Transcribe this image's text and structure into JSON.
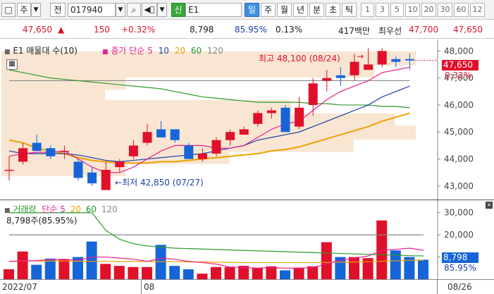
{
  "toolbar": {
    "market": "주",
    "all_label": "전",
    "code": "017940",
    "search_label": "Q",
    "signal_label": "신",
    "name": "E1",
    "period_tabs": [
      "일",
      "주",
      "월",
      "년",
      "분",
      "초",
      "틱"
    ],
    "active_period": "일",
    "interval_tabs": [
      "1",
      "3",
      "5",
      "10",
      "20",
      "30",
      "60",
      "12"
    ]
  },
  "quote": {
    "price": "47,650",
    "arrow": "▲",
    "change": "150",
    "change_pct": "+0.32%",
    "volume": "8,798",
    "vol_ratio": "85.95%",
    "turnover_pct": "0.13%",
    "amount": "417백만",
    "best_ask_label": "최우선",
    "ask": "47,700",
    "bid": "47,650"
  },
  "main_chart": {
    "legend_stock": "E1 매물대 수(10)",
    "legend_ma": "종가 단순",
    "ma_periods": [
      "5",
      "10",
      "20",
      "60",
      "120"
    ],
    "high_note": "최고 48,100 (08/24)",
    "low_note": "최저 42,850 (07/27)",
    "price_tag": "47,650",
    "pct_tag": "0.32%"
  },
  "volume_chart": {
    "legend": "거래량",
    "legend_ma": "단순",
    "ma_periods": [
      "5",
      "20",
      "60",
      "120"
    ],
    "current_note": "8,798주(85.95%)",
    "vol_tag": "8,798",
    "vol_pct_tag": "85.95%"
  },
  "x_labels": [
    "2022/07",
    "08",
    "08/26"
  ],
  "colors": {
    "up": "#e0102a",
    "down": "#1565d8",
    "ma5": "#e8208c",
    "ma10": "#1d3fa8",
    "ma20": "#f0a000",
    "ma60": "#2a9a2a",
    "ma120": "#888888",
    "profile": "#f8e6d2"
  },
  "chart_data": [
    {
      "type": "candlestick",
      "title": "E1",
      "ylim": [
        42500,
        48400
      ],
      "y_ticks": [
        43000,
        44000,
        45000,
        46000,
        47000,
        48000
      ],
      "candles": [
        {
          "o": 43600,
          "h": 44100,
          "l": 43200,
          "c": 43600
        },
        {
          "o": 43900,
          "h": 44600,
          "l": 43800,
          "c": 44400
        },
        {
          "o": 44600,
          "h": 44900,
          "l": 44300,
          "c": 44300
        },
        {
          "o": 44400,
          "h": 44500,
          "l": 44000,
          "c": 44100
        },
        {
          "o": 44300,
          "h": 44500,
          "l": 44000,
          "c": 44300
        },
        {
          "o": 43900,
          "h": 44000,
          "l": 43200,
          "c": 43300
        },
        {
          "o": 43500,
          "h": 43700,
          "l": 43000,
          "c": 43100
        },
        {
          "o": 42850,
          "h": 43900,
          "l": 42850,
          "c": 43600
        },
        {
          "o": 43700,
          "h": 44000,
          "l": 43500,
          "c": 43900
        },
        {
          "o": 44100,
          "h": 44700,
          "l": 44000,
          "c": 44500
        },
        {
          "o": 44600,
          "h": 45300,
          "l": 44500,
          "c": 45000
        },
        {
          "o": 45100,
          "h": 45400,
          "l": 44800,
          "c": 44800
        },
        {
          "o": 45100,
          "h": 45100,
          "l": 44600,
          "c": 44700
        },
        {
          "o": 44500,
          "h": 44600,
          "l": 44000,
          "c": 44000
        },
        {
          "o": 44000,
          "h": 44400,
          "l": 43900,
          "c": 44200
        },
        {
          "o": 44200,
          "h": 44800,
          "l": 44100,
          "c": 44700
        },
        {
          "o": 44700,
          "h": 45100,
          "l": 44500,
          "c": 45000
        },
        {
          "o": 44900,
          "h": 45200,
          "l": 44900,
          "c": 45100
        },
        {
          "o": 45300,
          "h": 45800,
          "l": 45200,
          "c": 45700
        },
        {
          "o": 45700,
          "h": 45900,
          "l": 45500,
          "c": 45800
        },
        {
          "o": 45900,
          "h": 46000,
          "l": 45000,
          "c": 45000
        },
        {
          "o": 45200,
          "h": 46300,
          "l": 45100,
          "c": 45900
        },
        {
          "o": 46000,
          "h": 47000,
          "l": 45600,
          "c": 46800
        },
        {
          "o": 46900,
          "h": 47300,
          "l": 46500,
          "c": 47000
        },
        {
          "o": 47100,
          "h": 47400,
          "l": 46700,
          "c": 47000
        },
        {
          "o": 47100,
          "h": 47900,
          "l": 46900,
          "c": 47600
        },
        {
          "o": 47300,
          "h": 48100,
          "l": 47300,
          "c": 47500
        },
        {
          "o": 47500,
          "h": 48100,
          "l": 47400,
          "c": 48000
        },
        {
          "o": 47700,
          "h": 47800,
          "l": 47400,
          "c": 47600
        },
        {
          "o": 47700,
          "h": 47900,
          "l": 47300,
          "c": 47650
        }
      ],
      "ma5": [
        44100,
        44200,
        44250,
        44250,
        44300,
        44000,
        43700,
        43500,
        43500,
        43700,
        44000,
        44300,
        44500,
        44500,
        44500,
        44400,
        44400,
        44500,
        44800,
        45100,
        45300,
        45400,
        45800,
        46200,
        46500,
        46700,
        46900,
        47200,
        47300,
        47400
      ],
      "ma10": [
        44300,
        44200,
        44200,
        44200,
        44200,
        44150,
        44050,
        43950,
        43900,
        43950,
        44000,
        44050,
        44100,
        44150,
        44200,
        44300,
        44400,
        44500,
        44700,
        44800,
        44900,
        45000,
        45200,
        45400,
        45600,
        45800,
        46000,
        46300,
        46500,
        46700
      ],
      "ma20": [
        44700,
        44600,
        44400,
        44300,
        44200,
        44050,
        43950,
        43900,
        43850,
        43850,
        43850,
        43900,
        43900,
        43950,
        44000,
        44050,
        44100,
        44150,
        44200,
        44300,
        44350,
        44450,
        44600,
        44750,
        44900,
        45050,
        45200,
        45400,
        45550,
        45700
      ],
      "ma60": [
        47300,
        47200,
        47100,
        47000,
        46950,
        46900,
        46850,
        46800,
        46750,
        46700,
        46650,
        46600,
        46500,
        46400,
        46300,
        46250,
        46200,
        46150,
        46100,
        46100,
        46100,
        46100,
        46050,
        46050,
        46000,
        46000,
        46000,
        45950,
        45950,
        45900
      ],
      "ma120": [
        46900,
        46900,
        46900,
        46900,
        46900,
        46900,
        46900,
        46900,
        46900,
        46900,
        46900,
        46900,
        46900,
        46900,
        46900,
        46900,
        46900,
        46900,
        46900,
        46900,
        46900,
        46900,
        46900,
        46900,
        46900,
        46900,
        46900,
        46900,
        46900,
        46900
      ],
      "volume_profile": [
        {
          "price": 47700,
          "weight": 1.0
        },
        {
          "price": 47250,
          "weight": 0.9
        },
        {
          "price": 46800,
          "weight": 0.3
        },
        {
          "price": 46350,
          "weight": 0.25
        },
        {
          "price": 45900,
          "weight": 0.7
        },
        {
          "price": 45400,
          "weight": 0.95
        },
        {
          "price": 44950,
          "weight": 1.0
        },
        {
          "price": 44500,
          "weight": 0.85
        },
        {
          "price": 44050,
          "weight": 0.55
        },
        {
          "price": 43600,
          "weight": 0.3
        }
      ]
    },
    {
      "type": "bar",
      "title": "거래량",
      "ylim": [
        0,
        35000
      ],
      "y_ticks": [
        10000,
        20000,
        30000
      ],
      "values": [
        4500,
        12500,
        6500,
        9300,
        9000,
        10000,
        17000,
        6900,
        6000,
        5500,
        5500,
        15500,
        6000,
        4500,
        2500,
        5500,
        5500,
        6000,
        5000,
        5800,
        4000,
        5200,
        5800,
        16700,
        10000,
        10000,
        9500,
        26500,
        13000,
        10000,
        8798
      ],
      "ma5": [
        8000,
        8200,
        8400,
        8800,
        9000,
        8500,
        10000,
        10000,
        9500,
        9000,
        8000,
        9500,
        9000,
        8000,
        7500,
        6800,
        5500,
        5200,
        5000,
        5200,
        5000,
        5000,
        5200,
        7000,
        8500,
        9500,
        10500,
        13000,
        13500,
        14000,
        13000
      ],
      "ma20": [
        8200,
        8200,
        8200,
        8200,
        8200,
        8100,
        8100,
        8100,
        8000,
        8000,
        8000,
        7900,
        7900,
        7800,
        7800,
        7700,
        7600,
        7500,
        7500,
        7500,
        7500,
        7500,
        7500,
        7600,
        7700,
        7800,
        7900,
        8100,
        8300,
        8500,
        8600
      ],
      "ma60": [
        30000,
        30000,
        30000,
        30000,
        30000,
        30000,
        30000,
        22000,
        18000,
        16000,
        15000,
        14500,
        14000,
        13800,
        13600,
        13400,
        13200,
        13000,
        12800,
        12600,
        12400,
        12200,
        12000,
        11800,
        11600,
        11400,
        11200,
        11000,
        10800,
        10600,
        10500
      ],
      "ma120": [
        20000,
        20000,
        20000,
        20000,
        20000,
        20000,
        20000,
        20000,
        20000,
        20000,
        20000,
        20000,
        20000,
        20000,
        20000,
        20000,
        20000,
        20000,
        20000,
        20000,
        20000,
        20000,
        20000,
        20000,
        20000,
        20000,
        20000,
        20000,
        20000,
        20000,
        20000
      ]
    }
  ]
}
